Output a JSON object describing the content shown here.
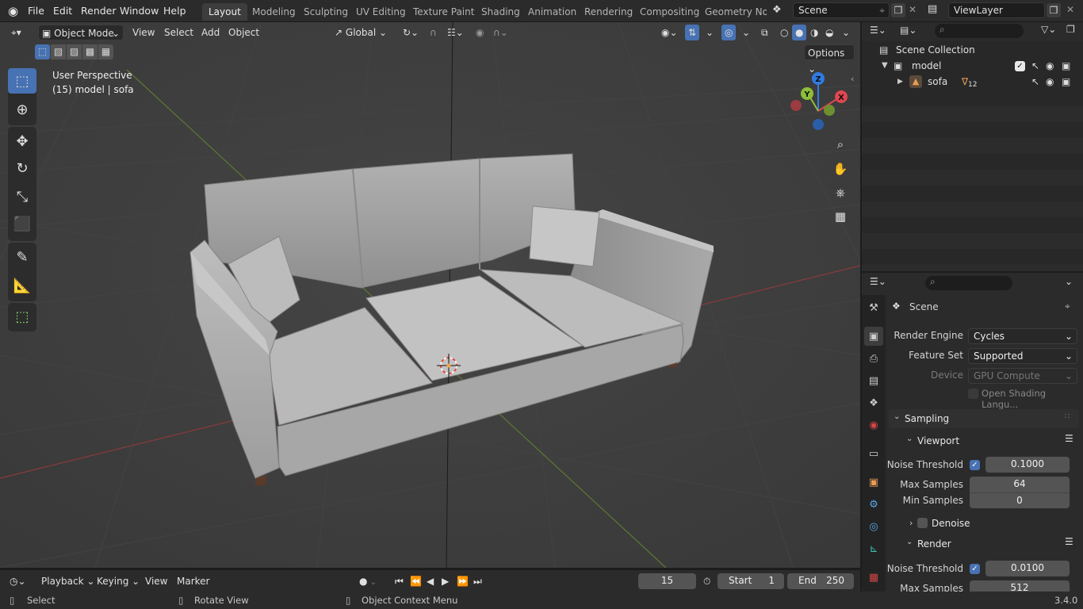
{
  "menu": {
    "items": [
      "File",
      "Edit",
      "Render",
      "Window",
      "Help"
    ],
    "workspaces": [
      "Layout",
      "Modeling",
      "Sculpting",
      "UV Editing",
      "Texture Paint",
      "Shading",
      "Animation",
      "Rendering",
      "Compositing",
      "Geometry Noc"
    ],
    "active_workspace": "Layout",
    "scene_name": "Scene",
    "view_layer": "ViewLayer"
  },
  "viewport": {
    "mode": "Object Mode",
    "menus": [
      "View",
      "Select",
      "Add",
      "Object"
    ],
    "transform_orientation": "Global",
    "options_label": "Options",
    "perspective": "User Perspective",
    "object_info": "(15) model | sofa",
    "gizmo_axes": [
      "X",
      "Y",
      "Z"
    ]
  },
  "outliner": {
    "root": "Scene Collection",
    "collection": "model",
    "object": "sofa",
    "modifier_count": "12"
  },
  "properties": {
    "header": "Scene",
    "render_engine_label": "Render Engine",
    "render_engine": "Cycles",
    "feature_set_label": "Feature Set",
    "feature_set": "Supported",
    "device_label": "Device",
    "device": "GPU Compute",
    "open_shading": "Open Shading Langu...",
    "sampling": "Sampling",
    "viewport_panel": "Viewport",
    "noise_threshold_label": "Noise Threshold",
    "viewport_noise_threshold": "0.1000",
    "max_samples_label": "Max Samples",
    "viewport_max_samples": "64",
    "min_samples_label": "Min Samples",
    "viewport_min_samples": "0",
    "denoise": "Denoise",
    "render_panel": "Render",
    "render_noise_threshold": "0.0100",
    "render_max_samples": "512"
  },
  "timeline": {
    "menus": [
      "Playback",
      "Keying",
      "View",
      "Marker"
    ],
    "current_frame": "15",
    "start_label": "Start",
    "start": "1",
    "end_label": "End",
    "end": "250"
  },
  "statusbar": {
    "select": "Select",
    "rotate": "Rotate View",
    "context": "Object Context Menu",
    "version": "3.4.0"
  },
  "colors": {
    "accent": "#4772b3",
    "axis_x": "#e0474f",
    "axis_y": "#8cbf3a",
    "axis_z": "#2f7ce3"
  }
}
